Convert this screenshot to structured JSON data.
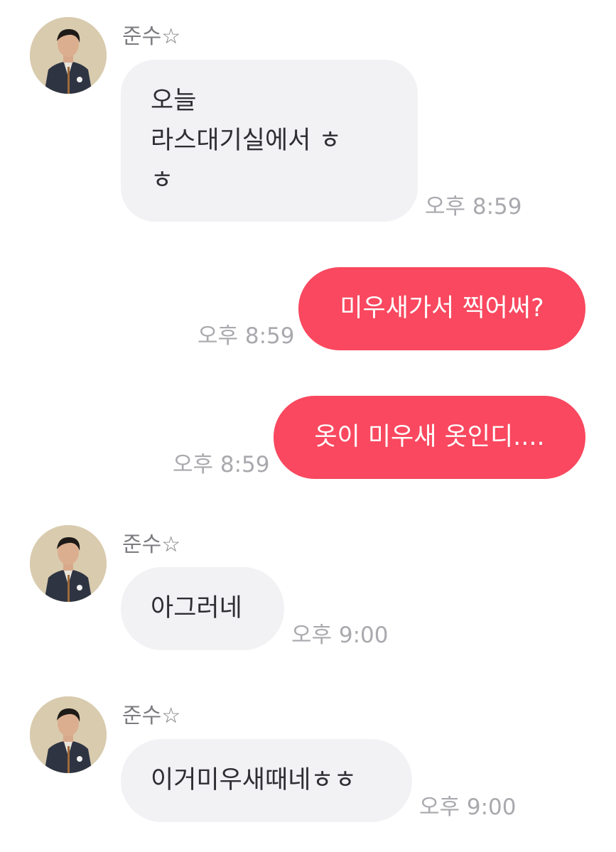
{
  "colors": {
    "outgoing_bubble": "#f9485f",
    "incoming_bubble": "#f2f2f5",
    "timestamp": "#a9a9ae",
    "sender_name": "#7b7b80"
  },
  "messages": [
    {
      "direction": "incoming",
      "sender": "준수☆",
      "avatar_icon": "profile-photo",
      "lines": [
        "오늘",
        "라스대기실에서 ㅎ",
        "ㅎ"
      ],
      "time": "오후 8:59"
    },
    {
      "direction": "outgoing",
      "lines": [
        "미우새가서 찍어써?"
      ],
      "time": "오후 8:59"
    },
    {
      "direction": "outgoing",
      "lines": [
        "옷이 미우새 옷인디...."
      ],
      "time": "오후 8:59"
    },
    {
      "direction": "incoming",
      "sender": "준수☆",
      "avatar_icon": "profile-photo",
      "lines": [
        "아그러네"
      ],
      "time": "오후 9:00"
    },
    {
      "direction": "incoming",
      "sender": "준수☆",
      "avatar_icon": "profile-photo",
      "lines": [
        "이거미우새때네ㅎㅎ"
      ],
      "time": "오후 9:00"
    }
  ]
}
